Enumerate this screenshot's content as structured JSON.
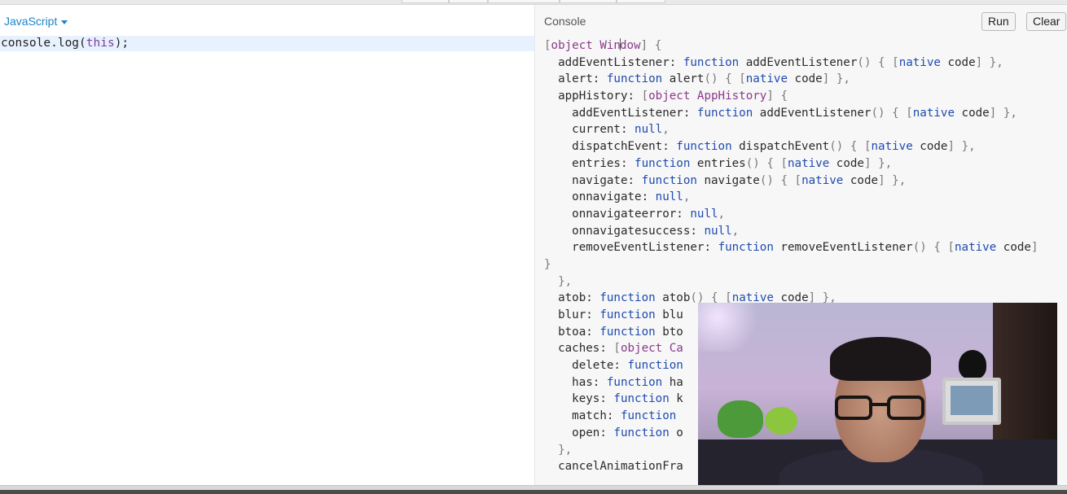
{
  "editor": {
    "language_label": "JavaScript",
    "code": {
      "prefix": "console.log(",
      "keyword": "this",
      "suffix": ");"
    }
  },
  "console": {
    "title": "Console",
    "run_label": "Run",
    "clear_label": "Clear",
    "output_lines": [
      "[object Window] {",
      "  addEventListener: function addEventListener() { [native code] },",
      "  alert: function alert() { [native code] },",
      "  appHistory: [object AppHistory] {",
      "    addEventListener: function addEventListener() { [native code] },",
      "    current: null,",
      "    dispatchEvent: function dispatchEvent() { [native code] },",
      "    entries: function entries() { [native code] },",
      "    navigate: function navigate() { [native code] },",
      "    onnavigate: null,",
      "    onnavigateerror: null,",
      "    onnavigatesuccess: null,",
      "    removeEventListener: function removeEventListener() { [native code]",
      "}",
      "  },",
      "  atob: function atob() { [native code] },",
      "  blur: function blu",
      "  btoa: function bto",
      "  caches: [object Ca",
      "    delete: function",
      "    has: function ha",
      "    keys: function k",
      "    match: function",
      "    open: function o",
      "  },",
      "  cancelAnimationFra"
    ]
  },
  "colors": {
    "accent": "#1a86c8",
    "keyword_this": "#7a3e9d",
    "console_bg": "#f7f7f7",
    "editor_highlight": "#e8f2ff"
  }
}
